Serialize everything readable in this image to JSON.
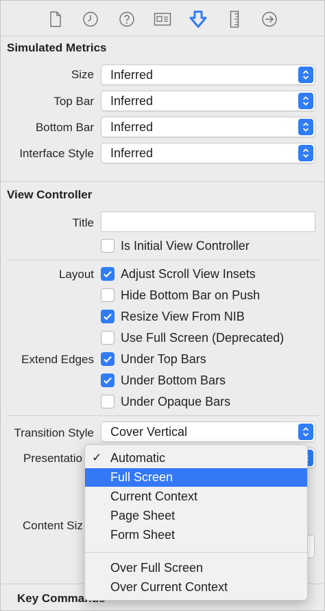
{
  "colors": {
    "accent": "#2f7cf6",
    "menu_selected": "#3478f6"
  },
  "toolbar": {
    "icons": [
      "file-icon",
      "clock-icon",
      "help-icon",
      "identity-card-icon",
      "attributes-icon",
      "ruler-icon",
      "connections-arrow-icon"
    ],
    "selected": "attributes-icon"
  },
  "simulated_metrics": {
    "title": "Simulated Metrics",
    "rows": [
      {
        "label": "Size",
        "value": "Inferred"
      },
      {
        "label": "Top Bar",
        "value": "Inferred"
      },
      {
        "label": "Bottom Bar",
        "value": "Inferred"
      },
      {
        "label": "Interface Style",
        "value": "Inferred"
      }
    ]
  },
  "view_controller": {
    "title": "View Controller",
    "title_label": "Title",
    "title_value": "",
    "initial_vc": {
      "label": "Is Initial View Controller",
      "checked": false
    },
    "layout_label": "Layout",
    "layout": [
      {
        "label": "Adjust Scroll View Insets",
        "checked": true
      },
      {
        "label": "Hide Bottom Bar on Push",
        "checked": false
      },
      {
        "label": "Resize View From NIB",
        "checked": true
      },
      {
        "label": "Use Full Screen (Deprecated)",
        "checked": false
      }
    ],
    "extend_edges_label": "Extend Edges",
    "extend_edges": [
      {
        "label": "Under Top Bars",
        "checked": true
      },
      {
        "label": "Under Bottom Bars",
        "checked": true
      },
      {
        "label": "Under Opaque Bars",
        "checked": false
      }
    ],
    "transition_style_label": "Transition Style",
    "transition_style_value": "Cover Vertical",
    "presentation_label": "Presentatio",
    "content_size_label": "Content Siz",
    "key_commands_label": "Key Commands"
  },
  "presentation_menu": {
    "checked_item": "Automatic",
    "highlighted_item": "Full Screen",
    "items": [
      "Automatic",
      "Full Screen",
      "Current Context",
      "Page Sheet",
      "Form Sheet",
      "Over Full Screen",
      "Over Current Context"
    ]
  }
}
